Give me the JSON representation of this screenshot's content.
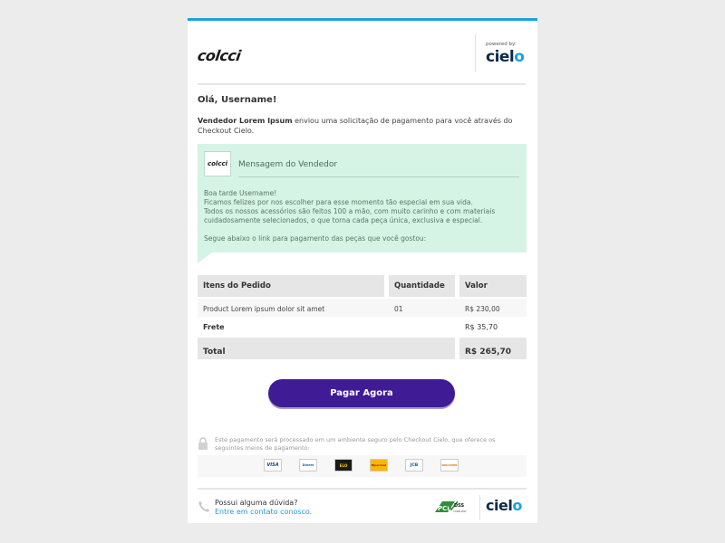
{
  "header": {
    "store_logo": "colcci",
    "powered_by": "powered by:",
    "processor_logo_prefix": "ciel",
    "processor_logo_suffix": "o"
  },
  "greeting": "Olá, Username!",
  "intro": {
    "seller": "Vendedor Lorem Ipsum",
    "text": " enviou uma solicitação de pagamento para você através do Checkout Cielo."
  },
  "seller_message": {
    "logo_text": "colcci",
    "title": "Mensagem do Vendedor",
    "paragraph1": "Boa tarde Username!\nFicamos felizes por nos escolher para esse momento tão especial em sua vida.\nTodos os nossos acessórios são feitos 100 a mão, com muito carinho e com materiais cuidadosamente selecionados, o que torna cada peça única, exclusiva e especial.",
    "paragraph2": "Segue abaixo o link para pagamento das peças que você gostou:"
  },
  "order": {
    "headers": {
      "item": "Itens do Pedido",
      "quantity": "Quantidade",
      "value": "Valor"
    },
    "rows": [
      {
        "item": "Product Lorem ipsum dolor sit amet",
        "quantity": "01",
        "value": "R$ 230,00"
      }
    ],
    "shipping_label": "Frete",
    "shipping_value": "R$ 35,70",
    "total_label": "Total",
    "total_value": "R$ 265,70"
  },
  "pay_button": "Pagar Agora",
  "secure_text": "Este pagamento será processado em um ambiente seguro pelo Checkout Cielo, que oferece os seguintes meios de pagamento:",
  "payment_methods": [
    "VISA",
    "Diners",
    "ELO",
    "Hipercard",
    "JCB",
    "DISCOVER"
  ],
  "footer": {
    "question": "Possui alguma dúvida?",
    "contact_link": "Entre em contato conosco.",
    "pci_label": "PCI DSS",
    "logo_prefix": "ciel",
    "logo_suffix": "o"
  },
  "colors": {
    "accent_top": "#1aa0dc",
    "button": "#3f1b96",
    "message_bg": "#d6f4e5",
    "link": "#1aa0dc"
  }
}
